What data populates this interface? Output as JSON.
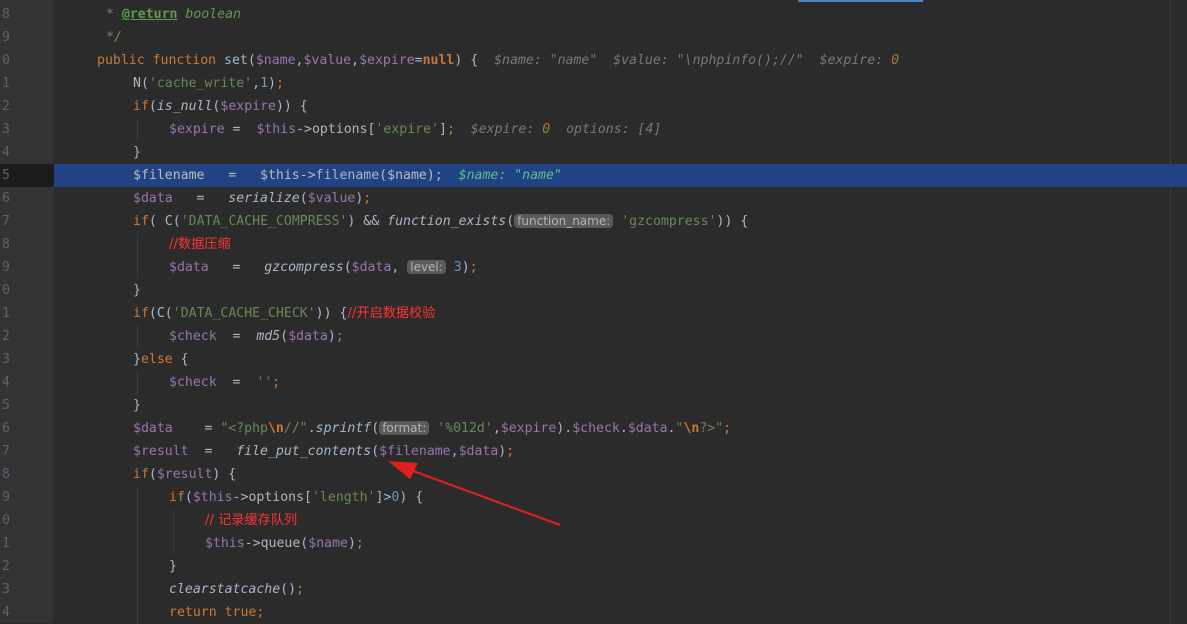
{
  "lines": [
    {
      "n": "8",
      "indent": 106,
      "html": "<span class='doc'>* </span><span class='doctag'>@return</span><span class='doc'> boolean</span>"
    },
    {
      "n": "9",
      "indent": 106,
      "html": "<span class='doc'>*/</span>"
    },
    {
      "n": "0",
      "indent": 97,
      "html": "<span class='kw'>public function </span><span class='fn'>set</span>(<span class='var'>$name</span>,<span class='var'>$value</span>,<span class='var'>$expire</span>=<span class='kwb'>null</span>) {  <span class='hint'>$name: \"name\"  $value: \"\\nphpinfo();//\"  $expire: </span><span class='hint' style='color:#a07a3e'>0</span>"
    },
    {
      "n": "1",
      "indent": 133,
      "html": "<span class='fn'>N</span>(<span class='str'>'cache_write'</span>,<span class='num'>1</span>)<span class='kw'>;</span>"
    },
    {
      "n": "2",
      "indent": 133,
      "html": "<span class='kw'>if</span>(<span class='fni'>is_null</span>(<span class='var'>$expire</span>)) {"
    },
    {
      "n": "3",
      "indent": 169,
      "html": "<span class='var'>$expire</span> =  <span class='var'>$this</span>-><span class='fn'>options</span>[<span class='str'>'expire'</span>]<span class='kw'>;</span>  <span class='hint'>$expire: </span><span class='hint' style='color:#a07a3e'>0</span><span class='hint'>  options: [4]</span>"
    },
    {
      "n": "4",
      "indent": 133,
      "html": "}"
    },
    {
      "n": "5",
      "indent": 133,
      "hl": true,
      "html": "<span class='var'>$filename</span>   =   <span class='var'>$this</span>-><span class='fn'>filename</span>(<span class='var'>$name</span>)<span>;</span>  <span class='hintg'>$name: \"name\"</span>"
    },
    {
      "n": "6",
      "indent": 133,
      "html": "<span class='var'>$data</span>   =   <span class='fni'>serialize</span>(<span class='var'>$value</span>)<span class='kw'>;</span>"
    },
    {
      "n": "7",
      "indent": 133,
      "html": "<span class='kw'>if</span>( <span class='fn'>C</span>(<span class='str'>'DATA_CACHE_COMPRESS'</span>) && <span class='fni'>function_exists</span>(<span class='badge'>function_name:</span> <span class='str'>'gzcompress'</span>)) {"
    },
    {
      "n": "8",
      "indent": 169,
      "html": "<span class='cn'>//数据压缩</span>"
    },
    {
      "n": "9",
      "indent": 169,
      "html": "<span class='var'>$data</span>   =   <span class='fni'>gzcompress</span>(<span class='var'>$data</span>, <span class='badge'>level:</span> <span class='num'>3</span>)<span class='kw'>;</span>"
    },
    {
      "n": "0",
      "indent": 133,
      "html": "}"
    },
    {
      "n": "1",
      "indent": 133,
      "html": "<span class='kw'>if</span>(<span class='fn'>C</span>(<span class='str'>'DATA_CACHE_CHECK'</span>)) {<span class='cn'>//开启数据校验</span>"
    },
    {
      "n": "2",
      "indent": 169,
      "html": "<span class='var'>$check</span>  =  <span class='fni'>md5</span>(<span class='var'>$data</span>)<span class='kw'>;</span>"
    },
    {
      "n": "3",
      "indent": 133,
      "html": "}<span class='kw'>else </span>{"
    },
    {
      "n": "4",
      "indent": 169,
      "html": "<span class='var'>$check</span>  =  <span class='str'>''</span><span class='kw'>;</span>"
    },
    {
      "n": "5",
      "indent": 133,
      "html": "}"
    },
    {
      "n": "6",
      "indent": 133,
      "html": "<span class='var'>$data</span>    = <span class='str'>\"&lt;?php</span><span class='esc'>\\n</span><span class='str'>//\"</span>.<span class='fni'>sprintf</span>(<span class='badge'>format:</span> <span class='str'>'%012d'</span>,<span class='var'>$expire</span>).<span class='var'>$check</span>.<span class='var'>$data</span>.<span class='str'>\"</span><span class='esc'>\\n</span><span class='str'>?&gt;\"</span><span class='kw'>;</span>"
    },
    {
      "n": "7",
      "indent": 133,
      "html": "<span class='var'>$result</span>  =   <span class='fni'>file_put_contents</span>(<span class='var'>$filename</span>,<span class='var'>$data</span>)<span class='kw'>;</span>"
    },
    {
      "n": "8",
      "indent": 133,
      "html": "<span class='kw'>if</span>(<span class='var'>$result</span>) {"
    },
    {
      "n": "9",
      "indent": 169,
      "html": "<span class='kw'>if</span>(<span class='var'>$this</span>-><span class='fn'>options</span>[<span class='str'>'length'</span>]><span class='num'>0</span>) {"
    },
    {
      "n": "0",
      "indent": 205,
      "html": "<span class='cn'>// 记录缓存队列</span>"
    },
    {
      "n": "1",
      "indent": 205,
      "html": "<span class='var'>$this</span>-><span class='fn'>queue</span>(<span class='var'>$name</span>)<span class='kw'>;</span>"
    },
    {
      "n": "2",
      "indent": 169,
      "html": "}"
    },
    {
      "n": "3",
      "indent": 169,
      "html": "<span class='fni'>clearstatcache</span>()<span class='kw'>;</span>"
    },
    {
      "n": "4",
      "indent": 169,
      "html": "<span class='kw'>return true;</span>"
    }
  ],
  "colors": {
    "background": "#2b2b2b",
    "selection": "#214283",
    "annotation_arrow": "#e02020"
  },
  "icons": {
    "annotation": "red-arrow"
  }
}
